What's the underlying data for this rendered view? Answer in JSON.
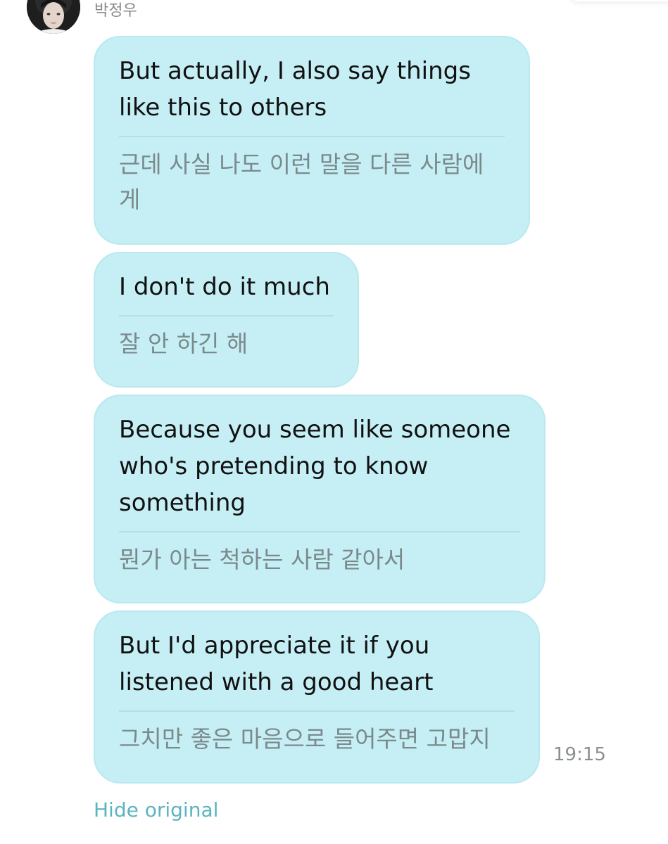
{
  "sender": {
    "name": "박정우",
    "avatar_icon": "profile-photo"
  },
  "messages": [
    {
      "translated": "But actually, I also say things like this to others",
      "original": "근데 사실 나도 이런 말을 다른 사람에게"
    },
    {
      "translated": "I don't do it much",
      "original": "잘 안 하긴 해"
    },
    {
      "translated": "Because you seem like someone who's pretending to know something",
      "original": "뭔가 아는 척하는 사람 같아서"
    },
    {
      "translated": "But I'd appreciate it if you listened with a good heart",
      "original": "그치만 좋은 마음으로 들어주면 고맙지"
    }
  ],
  "timestamp": "19:15",
  "hide_original_label": "Hide original",
  "colors": {
    "bubble_bg": "#c6eff5",
    "bubble_border": "#b8e8f0",
    "link": "#5db4c0"
  }
}
